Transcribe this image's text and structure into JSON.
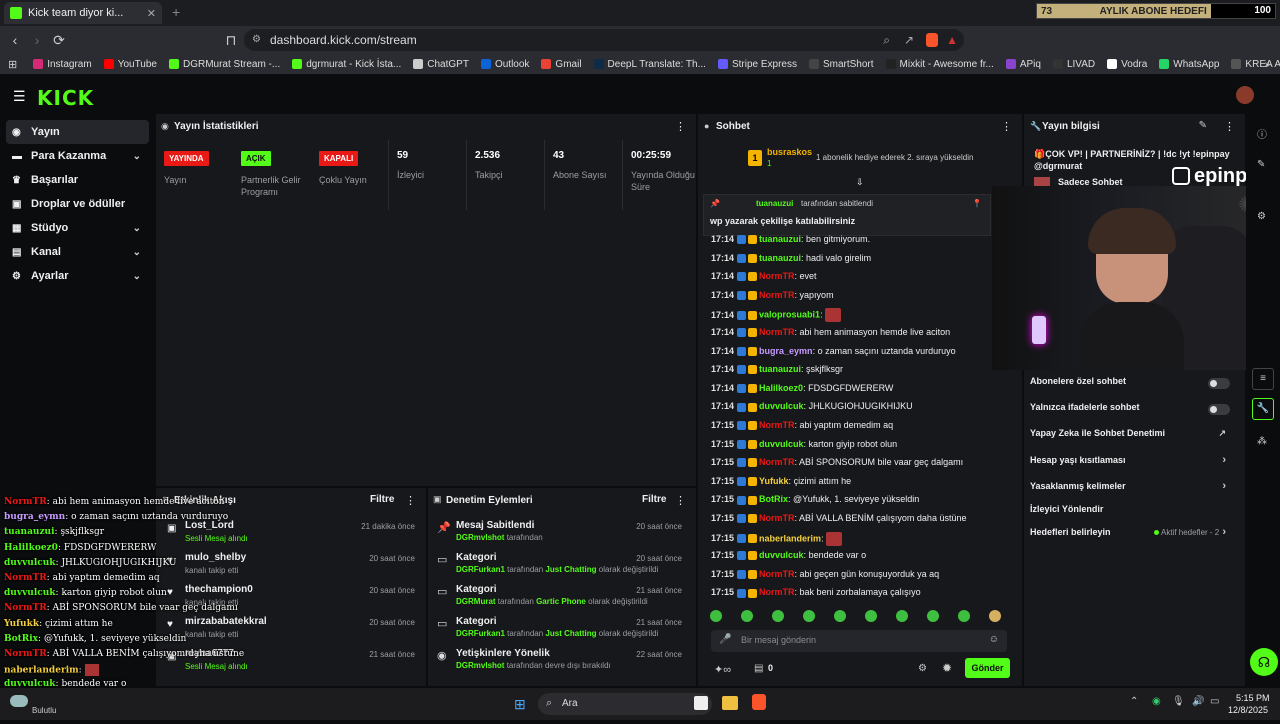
{
  "browser": {
    "tab_title": "Kick team diyor ki...",
    "tab_close": "✕",
    "new_tab": "+",
    "url": "dashboard.kick.com/stream",
    "bookmarks": [
      {
        "label": "Instagram",
        "color": "#d62976"
      },
      {
        "label": "YouTube",
        "color": "#ff0000"
      },
      {
        "label": "DGRMurat Stream -...",
        "color": "#53fc18"
      },
      {
        "label": "dgrmurat - Kick İsta...",
        "color": "#53fc18"
      },
      {
        "label": "ChatGPT",
        "color": "#cccccc"
      },
      {
        "label": "Outlook",
        "color": "#0a64d8"
      },
      {
        "label": "Gmail",
        "color": "#ea4335"
      },
      {
        "label": "DeepL Translate: Th...",
        "color": "#0f2b46"
      },
      {
        "label": "Stripe Express",
        "color": "#635bff"
      },
      {
        "label": "SmartShort",
        "color": "#444444"
      },
      {
        "label": "Mixkit - Awesome fr...",
        "color": "#222222"
      },
      {
        "label": "APiq",
        "color": "#8844cc"
      },
      {
        "label": "LIVAD",
        "color": "#333333"
      },
      {
        "label": "Vodra",
        "color": "#ffffff"
      },
      {
        "label": "WhatsApp",
        "color": "#25d366"
      },
      {
        "label": "KREA AI - Realtime...",
        "color": "#555555"
      }
    ]
  },
  "goal": {
    "current": "73",
    "label": "AYLIK ABONE HEDEFI",
    "target": "100",
    "progress": 0.73
  },
  "kick": {
    "logo": "KICK"
  },
  "sidebar": {
    "items": [
      {
        "label": "Yayın",
        "icon": "broadcast-icon",
        "active": true,
        "chevron": false
      },
      {
        "label": "Para Kazanma",
        "icon": "money-icon",
        "active": false,
        "chevron": true
      },
      {
        "label": "Başarılar",
        "icon": "trophy-icon",
        "active": false,
        "chevron": false
      },
      {
        "label": "Droplar ve ödüller",
        "icon": "gift-icon",
        "active": false,
        "chevron": false
      },
      {
        "label": "Stüdyo",
        "icon": "studio-icon",
        "active": false,
        "chevron": true
      },
      {
        "label": "Kanal",
        "icon": "channel-icon",
        "active": false,
        "chevron": true
      },
      {
        "label": "Ayarlar",
        "icon": "settings-icon",
        "active": false,
        "chevron": true
      }
    ]
  },
  "stats": {
    "title": "Yayın İstatistikleri",
    "columns": [
      {
        "badge": "YAYINDA",
        "badge_color": "#e91916",
        "badge_text_color": "#ffffff",
        "label": "Yayın"
      },
      {
        "badge": "AÇIK",
        "badge_color": "#53fc18",
        "badge_text_color": "#0b0c0e",
        "label": "Partnerlik Gelir Programı"
      },
      {
        "badge": "KAPALI",
        "badge_color": "#e91916",
        "badge_text_color": "#ffffff",
        "label": "Çoklu Yayın"
      },
      {
        "value": "59",
        "label": "İzleyici"
      },
      {
        "value": "2.536",
        "label": "Takipçi"
      },
      {
        "value": "43",
        "label": "Abone Sayısı"
      },
      {
        "value": "00:25:59",
        "label": "Yayında Olduğu Süre"
      }
    ]
  },
  "activity": {
    "title": "Etkinlik Akışı",
    "filter": "Filtre",
    "items": [
      {
        "name": "Lost_Lord",
        "sub": "Sesli Mesaj alındı",
        "sub_green": true,
        "time": "21 dakika önce",
        "icon": "gift-icon"
      },
      {
        "name": "mulo_shelby",
        "sub": "kanalı takip etti",
        "sub_green": false,
        "time": "20 saat önce",
        "icon": "heart-icon"
      },
      {
        "name": "thechampion0",
        "sub": "kanalı takip etti",
        "sub_green": false,
        "time": "20 saat önce",
        "icon": "heart-icon"
      },
      {
        "name": "mirzababatekkral",
        "sub": "kanalı takip etti",
        "sub_green": false,
        "time": "20 saat önce",
        "icon": "heart-icon"
      },
      {
        "name": "reyna6777",
        "sub": "Sesli Mesaj alındı",
        "sub_green": true,
        "time": "21 saat önce",
        "icon": "gift-icon"
      }
    ]
  },
  "moderation": {
    "title": "Denetim Eylemleri",
    "filter": "Filtre",
    "items": [
      {
        "name": "Mesaj Sabitlendi",
        "actor": "DGRmvlshot",
        "mid": "tarafından",
        "target": "",
        "tail": "",
        "time": "20 saat önce",
        "icon": "pin-icon"
      },
      {
        "name": "Kategori",
        "actor": "DGRFurkan1",
        "mid": "tarafından",
        "target": "Just Chatting",
        "tail": "olarak değiştirildi",
        "time": "20 saat önce",
        "icon": "category-icon"
      },
      {
        "name": "Kategori",
        "actor": "DGRMurat",
        "mid": "tarafından",
        "target": "Gartic Phone",
        "tail": "olarak değiştirildi",
        "time": "21 saat önce",
        "icon": "category-icon"
      },
      {
        "name": "Kategori",
        "actor": "DGRFurkan1",
        "mid": "tarafından",
        "target": "Just Chatting",
        "tail": "olarak değiştirildi",
        "time": "21 saat önce",
        "icon": "category-icon"
      },
      {
        "name": "Yetişkinlere Yönelik",
        "actor": "DGRmvlshot",
        "mid": "tarafından devre dışı bırakıldı",
        "target": "",
        "tail": "",
        "time": "22 saat önce",
        "icon": "eye-icon"
      }
    ]
  },
  "chat": {
    "title": "Sohbet",
    "gifter": {
      "name": "busraskos",
      "count": "1",
      "rank": "1",
      "note": "1 abonelik hediye ederek 2. sıraya yükseldin"
    },
    "pinned": {
      "by_user": "tuanauzui",
      "by_label": "tarafından sabitlendi",
      "text": "wp yazarak çekilişe katılabilirsiniz"
    },
    "messages": [
      {
        "time": "17:14",
        "user": "tuanauzui",
        "color": "#53fc18",
        "text": "ben gitmiyorum."
      },
      {
        "time": "17:14",
        "user": "tuanauzui",
        "color": "#53fc18",
        "text": "hadi valo girelim"
      },
      {
        "time": "17:14",
        "user": "NormTR",
        "color": "#e91916",
        "text": "evet"
      },
      {
        "time": "17:14",
        "user": "NormTR",
        "color": "#e91916",
        "text": "yapıyom"
      },
      {
        "time": "17:14",
        "user": "valoprosuabi1",
        "color": "#53fc18",
        "text": ""
      },
      {
        "time": "17:14",
        "user": "NormTR",
        "color": "#e91916",
        "text": "abi hem animasyon hemde live aciton"
      },
      {
        "time": "17:14",
        "user": "bugra_eymn",
        "color": "#c79bff",
        "text": "o zaman saçını uztanda vurduruyo"
      },
      {
        "time": "17:14",
        "user": "tuanauzui",
        "color": "#53fc18",
        "text": "şskjflksgr"
      },
      {
        "time": "17:14",
        "user": "Halilkoez0",
        "color": "#53fc18",
        "text": "FDSDGFDWERERW"
      },
      {
        "time": "17:14",
        "user": "duvvulcuk",
        "color": "#53fc18",
        "text": "JHLKUGIOHJUGIKHIJKU"
      },
      {
        "time": "17:15",
        "user": "NormTR",
        "color": "#e91916",
        "text": "abi yaptım demedim aq"
      },
      {
        "time": "17:15",
        "user": "duvvulcuk",
        "color": "#53fc18",
        "text": "karton giyip robot olun"
      },
      {
        "time": "17:15",
        "user": "NormTR",
        "color": "#e91916",
        "text": "ABİ SPONSORUM bile vaar geç dalgamı"
      },
      {
        "time": "17:15",
        "user": "Yufukk",
        "color": "#f4d03f",
        "text": "çizimi attım he"
      },
      {
        "time": "17:15",
        "user": "BotRix",
        "color": "#53fc18",
        "text": "@Yufukk, 1. seviyeye yükseldin"
      },
      {
        "time": "17:15",
        "user": "NormTR",
        "color": "#e91916",
        "text": "ABİ VALLA BENİM çalışıyom daha üstüne"
      },
      {
        "time": "17:15",
        "user": "naberlanderim",
        "color": "#f4d03f",
        "text": ""
      },
      {
        "time": "17:15",
        "user": "duvvulcuk",
        "color": "#53fc18",
        "text": "bendede var o"
      },
      {
        "time": "17:15",
        "user": "NormTR",
        "color": "#e91916",
        "text": "abi geçen gün konuşuyorduk ya aq"
      },
      {
        "time": "17:15",
        "user": "NormTR",
        "color": "#e91916",
        "text": "bak beni zorbalamaya çalışıyo"
      }
    ],
    "input_placeholder": "Bir mesaj gönderin",
    "points": "0",
    "send_label": "Gönder"
  },
  "streaminfo": {
    "title": "Yayın bilgisi",
    "stream_title": "🎁ÇOK VP! | PARTNERİNİZ? | !dc !yt !epinpay @dgrmurat",
    "mode": "Sadece Sohbet",
    "sponsor": "epinpay",
    "rows": [
      {
        "label": "Abonelere özel sohbet",
        "kind": "toggle"
      },
      {
        "label": "Yalnızca ifadelerle sohbet",
        "kind": "toggle"
      },
      {
        "label": "Yapay Zeka ile Sohbet Denetimi",
        "kind": "external"
      },
      {
        "label": "Hesap yaşı kısıtlaması",
        "kind": "chevron"
      },
      {
        "label": "Yasaklanmış kelimeler",
        "kind": "chevron"
      },
      {
        "label": "İzleyici Yönlendir",
        "kind": "none"
      },
      {
        "label": "Hedefleri belirleyin",
        "kind": "goal",
        "extra": "Aktif hedefler - 2"
      }
    ]
  },
  "overlay_chat": [
    {
      "user": "NormTR",
      "color": "#e91916",
      "text": "abi hem animasyon hemde live aciton"
    },
    {
      "user": "bugra_eymn",
      "color": "#c79bff",
      "text": "o zaman saçını uztanda vurduruyo"
    },
    {
      "user": "tuanauzui",
      "color": "#53fc18",
      "text": "şskjflksgr"
    },
    {
      "user": "Halilkoez0",
      "color": "#53fc18",
      "text": "FDSDGFDWERERW"
    },
    {
      "user": "duvvulcuk",
      "color": "#53fc18",
      "text": "JHLKUGIOHJUGIKHIJKU"
    },
    {
      "user": "NormTR",
      "color": "#e91916",
      "text": "abi yaptım demedim aq"
    },
    {
      "user": "duvvulcuk",
      "color": "#53fc18",
      "text": "karton giyip robot olun"
    },
    {
      "user": "NormTR",
      "color": "#e91916",
      "text": "ABİ SPONSORUM bile vaar geç dalgamı"
    },
    {
      "user": "Yufukk",
      "color": "#f4d03f",
      "text": "çizimi attım he"
    },
    {
      "user": "BotRix",
      "color": "#53fc18",
      "text": "@Yufukk, 1. seviyeye yükseldin"
    },
    {
      "user": "NormTR",
      "color": "#e91916",
      "text": "ABİ VALLA BENİM çalışıyom daha üstüne"
    },
    {
      "user": "naberlanderim",
      "color": "#f4d03f",
      "text": ""
    },
    {
      "user": "duvvulcuk",
      "color": "#53fc18",
      "text": "bendede var o"
    },
    {
      "user": "NormTR",
      "color": "#e91916",
      "text": "abi geçen gün konuşuyorduk ya aq"
    },
    {
      "user": "NormTR",
      "color": "#e91916",
      "text": "bak beni zorbalamaya çalışıyo"
    }
  ],
  "taskbar": {
    "search_label": "Ara",
    "time": "5:15 PM",
    "date": "12/8/2025",
    "weather_label": "Bulutlu"
  }
}
